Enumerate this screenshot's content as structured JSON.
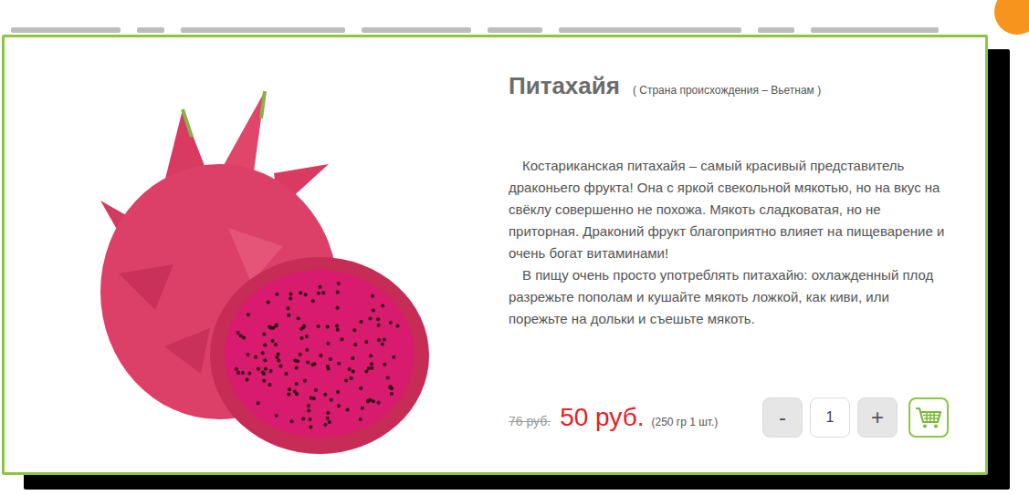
{
  "product": {
    "title": "Питахайя",
    "origin": "( Страна происхождения  – Вьетнам )",
    "description": [
      "Костариканская питахайя – самый красивый представитель драконьего фрукта! Она с яркой свекольной мякотью, но на вкус на свёклу совершенно не похожа. Мякоть сладковатая, но не приторная. Драконий фрукт благоприятно влияет на пищеварение и очень богат витаминами!",
      "В пищу очень просто употреблять питахайю: охлажденный плод разрежьте пополам и кушайте мякоть ложкой, как киви, или порежьте на дольки и съешьте мякоть."
    ]
  },
  "price": {
    "old": "76 руб.",
    "current": "50 руб.",
    "unit": "(250 гр 1 шт.)"
  },
  "quantity": {
    "minus": "-",
    "value": "1",
    "plus": "+"
  }
}
